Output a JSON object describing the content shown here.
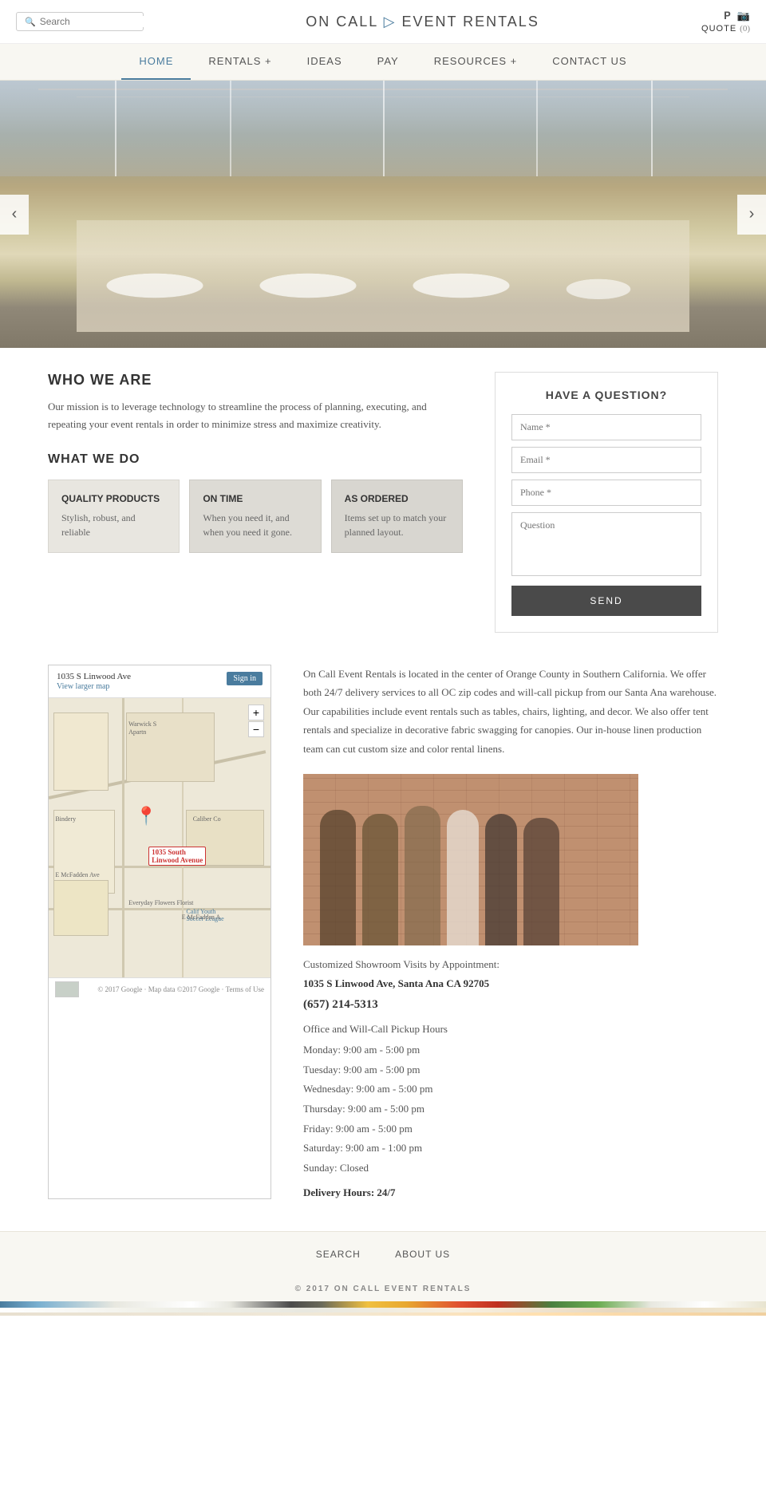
{
  "header": {
    "search_placeholder": "Search",
    "logo_text": "ON CALL",
    "logo_arrow": "▷",
    "logo_suffix": "EVENT RENTALS",
    "quote_label": "QUOTE",
    "quote_count": "(0)"
  },
  "nav": {
    "items": [
      {
        "label": "HOME",
        "active": true
      },
      {
        "label": "RENTALS +",
        "active": false
      },
      {
        "label": "IDEAS",
        "active": false
      },
      {
        "label": "PAY",
        "active": false
      },
      {
        "label": "RESOURCES +",
        "active": false
      },
      {
        "label": "CONTACT US",
        "active": false
      }
    ]
  },
  "who_we_are": {
    "title": "WHO WE ARE",
    "description": "Our mission is to leverage technology to streamline the process of planning, executing, and repeating your event rentals in order to minimize stress and maximize creativity."
  },
  "what_we_do": {
    "title": "WHAT WE DO",
    "features": [
      {
        "title": "QUALITY PRODUCTS",
        "text": "Stylish, robust, and reliable"
      },
      {
        "title": "ON TIME",
        "text": "When you need it, and when you need it gone."
      },
      {
        "title": "AS ORDERED",
        "text": "Items set up to match your planned layout."
      }
    ]
  },
  "contact_form": {
    "title": "HAVE A QUESTION?",
    "name_placeholder": "Name *",
    "email_placeholder": "Email *",
    "phone_placeholder": "Phone *",
    "question_placeholder": "Question",
    "send_label": "SEND"
  },
  "location": {
    "map_address": "1035 S Linwood Ave",
    "map_link": "View larger map",
    "map_pin_label": "1035 South Linwood Avenue",
    "map_labels": [
      "Warwick S\nApartn",
      "Bindery",
      "Everyday Flowers Florist",
      "Calif Youth\nSoccer League",
      "Caliber Co",
      "E McFadden Ave",
      "E McFadden A"
    ],
    "description": "On Call Event Rentals is located in the center of Orange County in Southern California. We offer both 24/7 delivery services to all OC zip codes and will-call pickup from our Santa Ana warehouse. Our capabilities include event rentals such as tables, chairs, lighting, and decor. We also offer tent rentals and specialize in decorative fabric swagging for canopies. Our in-house linen production team can cut custom size and color rental linens.",
    "photo_caption": "Customized Showroom Visits by Appointment:",
    "address": "1035 S Linwood Ave, Santa Ana CA 92705",
    "phone": "(657) 214-5313",
    "hours_title": "Office and Will-Call Pickup Hours",
    "hours": [
      "Monday: 9:00 am - 5:00 pm",
      "Tuesday: 9:00 am - 5:00 pm",
      "Wednesday: 9:00 am - 5:00 pm",
      "Thursday: 9:00 am - 5:00 pm",
      "Friday: 9:00 am - 5:00 pm",
      "Saturday: 9:00 am - 1:00 pm",
      "Sunday: Closed"
    ],
    "delivery_hours": "Delivery Hours: 24/7"
  },
  "footer": {
    "links": [
      {
        "label": "SEARCH"
      },
      {
        "label": "ABOUT US"
      }
    ],
    "copyright": "© 2017 ON CALL EVENT RENTALS"
  }
}
